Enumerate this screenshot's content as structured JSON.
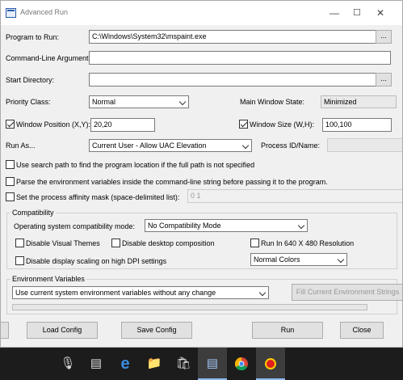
{
  "window": {
    "title": "Advanced Run"
  },
  "form": {
    "program_label": "Program to Run:",
    "program_value": "C:\\Windows\\System32\\mspaint.exe",
    "args_label": "Command-Line Arguments:",
    "args_value": "",
    "startdir_label": "Start Directory:",
    "startdir_value": "",
    "browse_label": "...",
    "priority_label": "Priority Class:",
    "priority_value": "Normal",
    "mainwin_label": "Main Window State:",
    "mainwin_value": "Minimized",
    "winpos_label": "Window Position (X,Y):",
    "winpos_value": "20,20",
    "winpos_checked": true,
    "winsize_label": "Window Size (W,H):",
    "winsize_value": "100,100",
    "winsize_checked": true,
    "runas_label": "Run As...",
    "runas_value": "Current User - Allow UAC Elevation",
    "pid_label": "Process ID/Name:",
    "search_path_label": "Use search path to find the program location if the full path is not specified",
    "parse_env_label": "Parse the environment variables inside the command-line string before passing it to the program.",
    "affinity_label": "Set the process affinity mask (space-delimited list):",
    "affinity_value": "0 1"
  },
  "compat": {
    "group_label": "Compatibility",
    "mode_label": "Operating system compatibility mode:",
    "mode_value": "No Compatibility Mode",
    "themes_label": "Disable Visual Themes",
    "desktop_comp_label": "Disable desktop composition",
    "res640_label": "Run In 640 X 480 Resolution",
    "dpi_label": "Disable display scaling on high DPI settings",
    "colors_value": "Normal Colors"
  },
  "env": {
    "group_label": "Environment Variables",
    "mode_value": "Use current system environment variables without any change",
    "fill_label": "Fill Current Environment Strings"
  },
  "buttons": {
    "load": "Load Config",
    "save": "Save Config",
    "run": "Run",
    "close": "Close"
  },
  "taskbar": {
    "mic_icon": "microphone-icon",
    "taskview_icon": "task-view-icon",
    "edge_icon": "edge-icon",
    "explorer_icon": "file-explorer-icon",
    "store_icon": "store-icon",
    "advrun_icon": "advanced-run-icon",
    "chrome_icon": "chrome-icon",
    "app_icon": "red-app-icon"
  }
}
